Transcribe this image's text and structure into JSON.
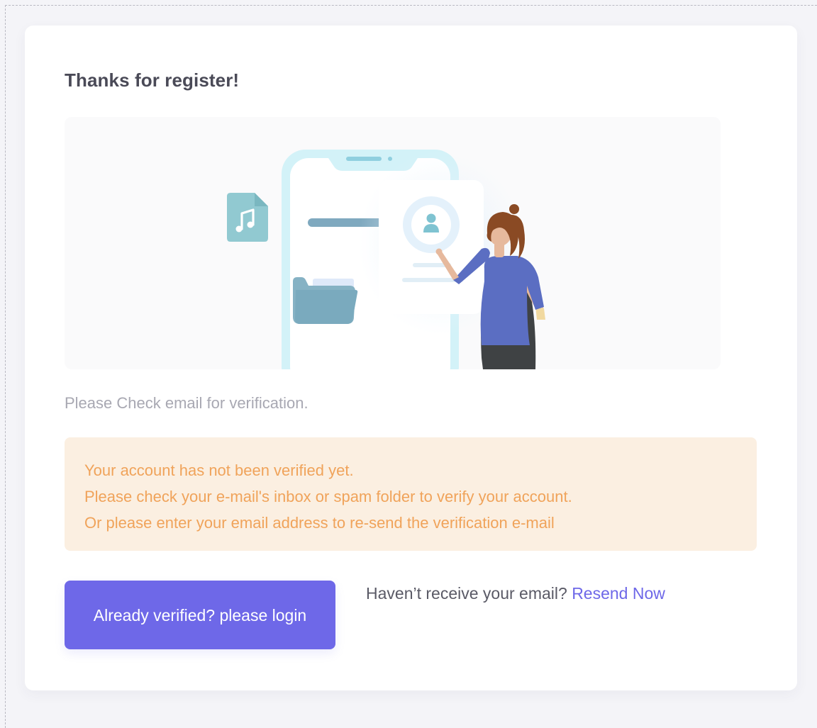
{
  "page": {
    "title": "Thanks for register!",
    "check_text": "Please Check email for verification.",
    "alert": {
      "lines": [
        "Your account has not been verified yet.",
        "Please check your e-mail's inbox or spam folder to verify your account.",
        "Or please enter your email address to re-send the verification e-mail"
      ]
    },
    "login_button_label": "Already verified? please login",
    "resend": {
      "prompt": "Haven’t receive your email?",
      "link_label": "Resend Now"
    }
  },
  "colors": {
    "accent": "#6e68e8",
    "alert_background": "#fbefe1",
    "alert_text": "#f0a35a",
    "title_text": "#4a4a57",
    "muted_text": "#a8a8b2"
  },
  "icons": {
    "file": "music-file-icon",
    "avatar": "user-avatar-icon",
    "folder": "folder-icon"
  }
}
